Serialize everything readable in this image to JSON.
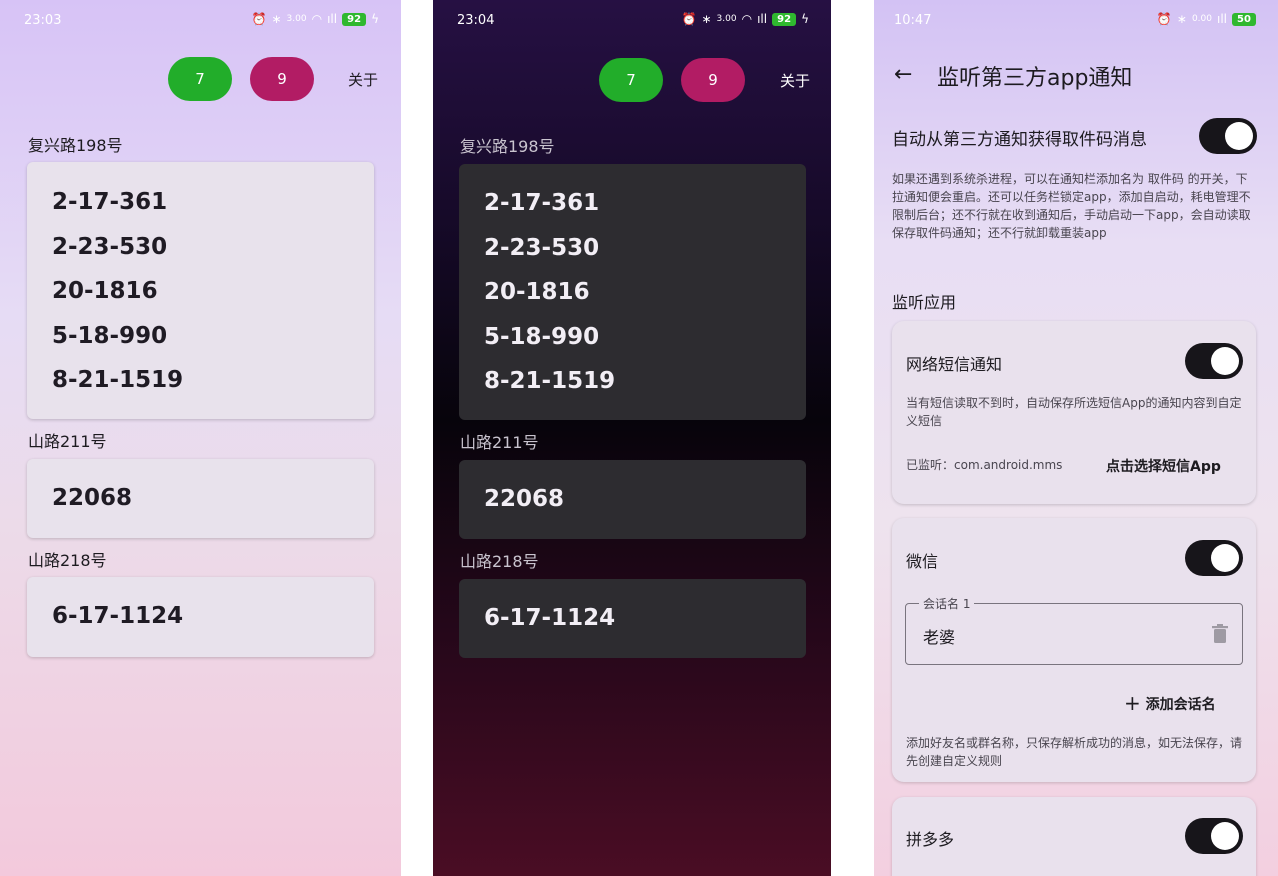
{
  "screen1": {
    "status": {
      "time": "23:03",
      "battery": "92",
      "net_speed": "3.00"
    },
    "buttons": {
      "green": "7",
      "pink": "9",
      "about": "关于"
    },
    "groups": [
      {
        "address": "复兴路198号",
        "codes": [
          "2-17-361",
          "2-23-530",
          "20-1816",
          "5-18-990",
          "8-21-1519"
        ]
      },
      {
        "address": "山路211号",
        "codes": [
          "22068"
        ]
      },
      {
        "address": "山路218号",
        "codes": [
          "6-17-1124"
        ]
      }
    ]
  },
  "screen2": {
    "status": {
      "time": "23:04",
      "battery": "92",
      "net_speed": "3.00"
    },
    "buttons": {
      "green": "7",
      "pink": "9",
      "about": "关于"
    },
    "groups": [
      {
        "address": "复兴路198号",
        "codes": [
          "2-17-361",
          "2-23-530",
          "20-1816",
          "5-18-990",
          "8-21-1519"
        ]
      },
      {
        "address": "山路211号",
        "codes": [
          "22068"
        ]
      },
      {
        "address": "山路218号",
        "codes": [
          "6-17-1124"
        ]
      }
    ]
  },
  "screen3": {
    "status": {
      "time": "10:47",
      "battery": "50",
      "net_speed": "0.00"
    },
    "title": "监听第三方app通知",
    "auto_label": "自动从第三方通知获得取件码消息",
    "auto_enabled": true,
    "auto_desc": "如果还遇到系统杀进程，可以在通知栏添加名为 取件码 的开关，下拉通知便会重启。还可以任务栏锁定app，添加自启动，耗电管理不限制后台；还不行就在收到通知后，手动启动一下app，会自动读取保存取件码通知；还不行就卸载重装app",
    "section": "监听应用",
    "sms": {
      "title": "网络短信通知",
      "enabled": true,
      "desc": "当有短信读取不到时，自动保存所选短信App的通知内容到自定义短信",
      "monitored": "已监听：com.android.mms",
      "select_button": "点击选择短信App"
    },
    "wechat": {
      "title": "微信",
      "enabled": true,
      "field_label": "会话名 1",
      "field_value": "老婆",
      "add_button": "添加会话名",
      "desc": "添加好友名或群名称，只保存解析成功的消息，如无法保存，请先创建自定义规则"
    },
    "pdd": {
      "title": "拼多多",
      "enabled": true
    }
  }
}
